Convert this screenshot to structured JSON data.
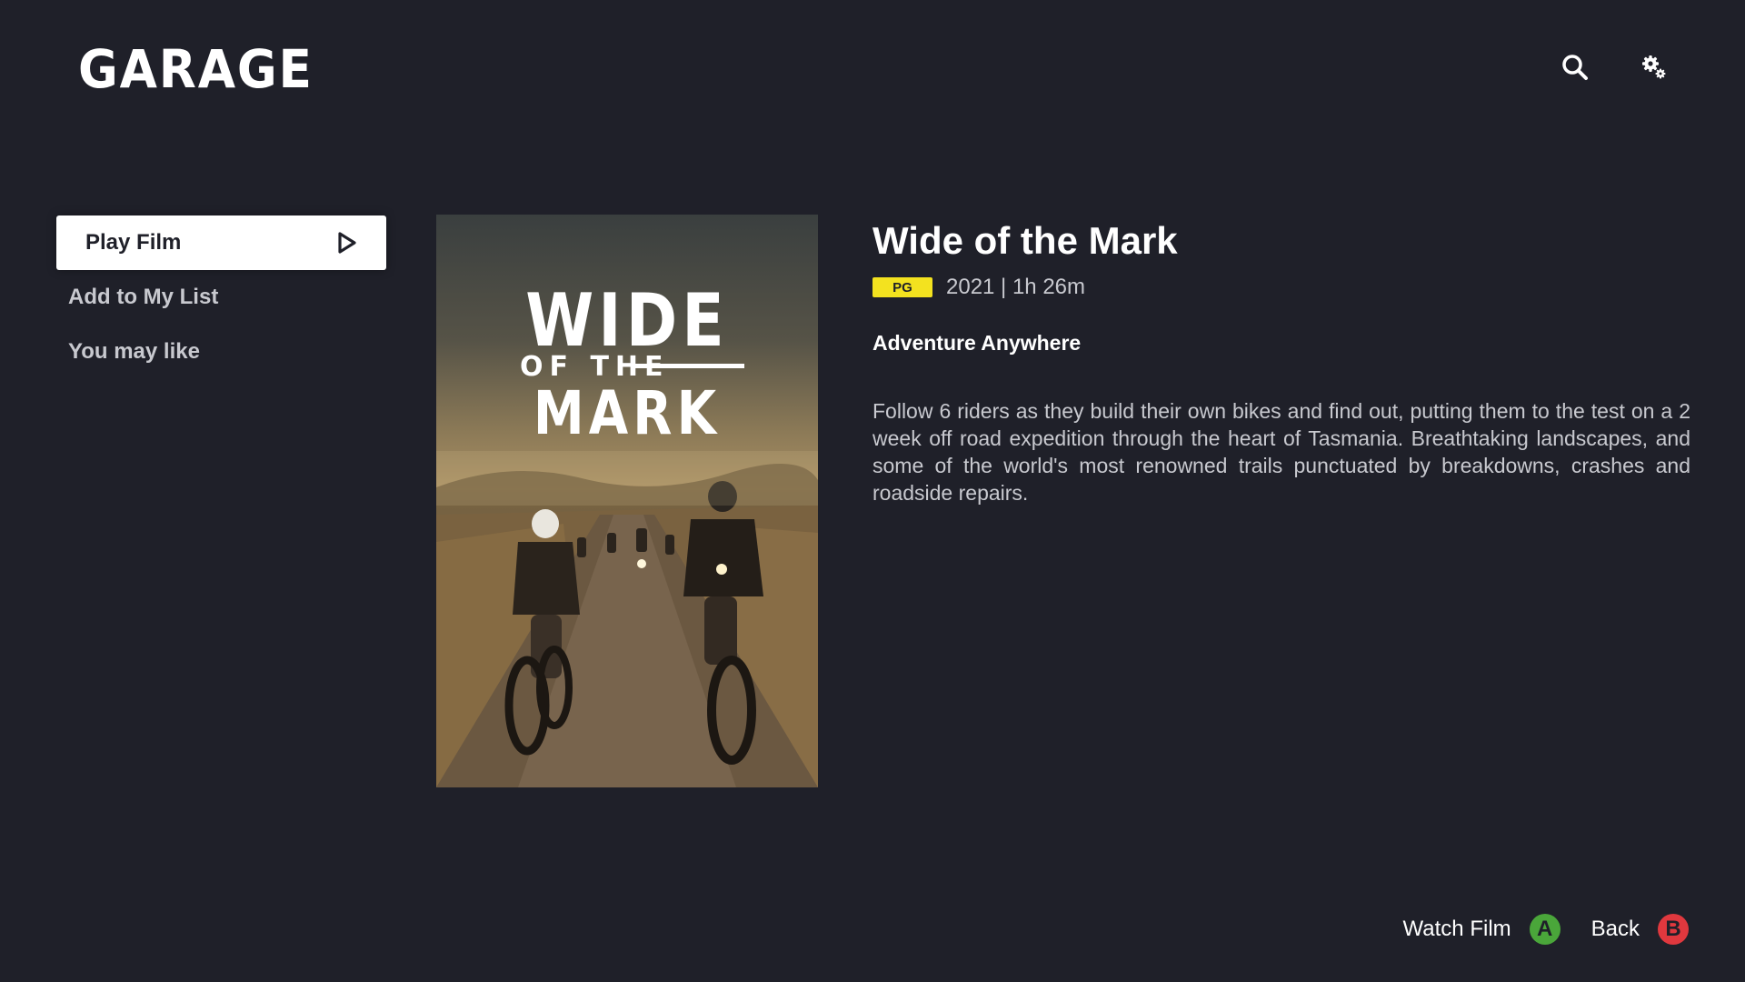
{
  "header": {
    "logo": "GARAGE",
    "search_icon": "search-icon",
    "settings_icon": "gears-icon"
  },
  "menu": {
    "items": [
      {
        "label": "Play Film",
        "active": true,
        "icon": "play-icon"
      },
      {
        "label": "Add to My List",
        "active": false
      },
      {
        "label": "You may like",
        "active": false
      }
    ]
  },
  "poster": {
    "line1": "WIDE",
    "line2": "OF THE",
    "line3": "MARK"
  },
  "film": {
    "title": "Wide of the Mark",
    "rating": "PG",
    "meta": "2021 | 1h 26m",
    "tagline": "Adventure Anywhere",
    "synopsis": "Follow 6 riders as they build their own bikes and find out, putting them to the test on a 2 week off road expedition through the heart of Tasmania. Breathtaking landscapes, and some of the world's most renowned trails punctuated by breakdowns, crashes and roadside repairs."
  },
  "hints": [
    {
      "label": "Watch Film",
      "button": "A",
      "color": "#4aa63a"
    },
    {
      "label": "Back",
      "button": "B",
      "color": "#e0383e"
    }
  ],
  "colors": {
    "background": "#1f2029",
    "rating_badge": "#f3e21f",
    "muted_text": "#c8c9cf"
  }
}
